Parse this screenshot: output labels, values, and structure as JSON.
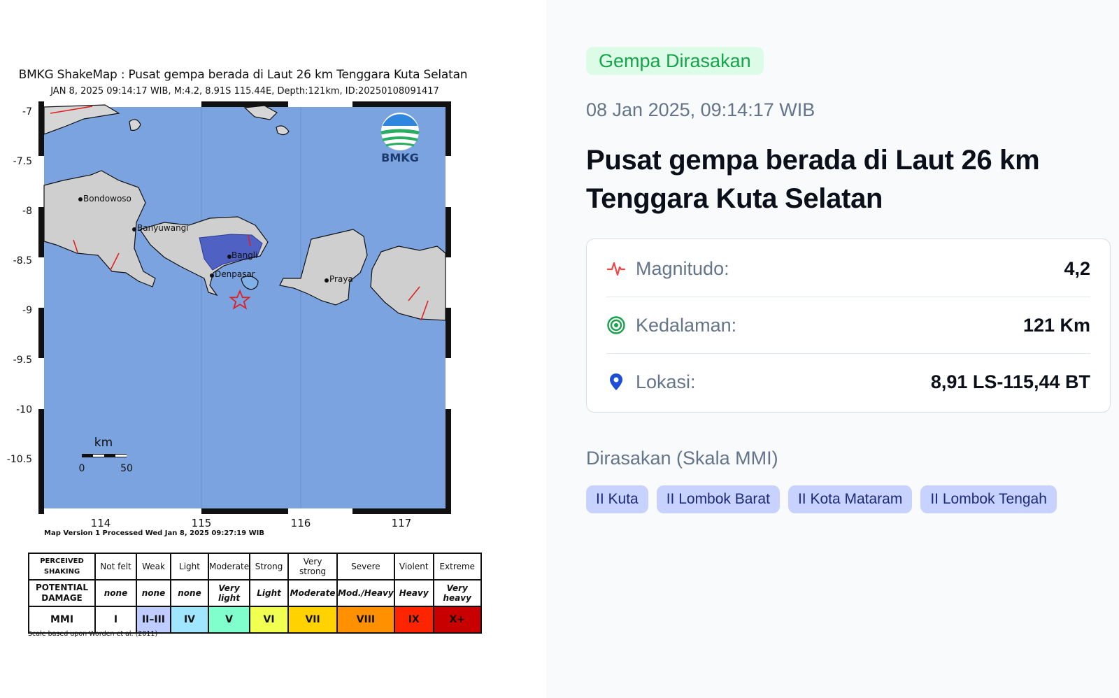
{
  "shakemap": {
    "title": "BMKG ShakeMap : Pusat gempa berada di Laut 26 km Tenggara Kuta Selatan",
    "subtitle": "JAN 8, 2025 09:14:17 WIB, M:4.2, 8.91S 115.44E, Depth:121km, ID:20250108091417",
    "logo_text": "BMKG",
    "lat_ticks": [
      "-7",
      "-7.5",
      "-8",
      "-8.5",
      "-9",
      "-9.5",
      "-10",
      "-10.5"
    ],
    "lon_ticks": [
      "114",
      "115",
      "116",
      "117"
    ],
    "cities": [
      "Bondowoso",
      "Banyuwangi",
      "Bangli",
      "Denpasar",
      "Praya"
    ],
    "scale_unit": "km",
    "scale_min": "0",
    "scale_max": "50",
    "map_version": "Map Version 1 Processed Wed Jan  8, 2025 09:27:19 WIB",
    "scale_note": "Scale based upon Worden et al. (2011)",
    "legend": {
      "perceived_label": "PERCEIVED SHAKING",
      "damage_label": "POTENTIAL DAMAGE",
      "mmi_label": "MMI",
      "perceived": [
        "Not felt",
        "Weak",
        "Light",
        "Moderate",
        "Strong",
        "Very strong",
        "Severe",
        "Violent",
        "Extreme"
      ],
      "damage": [
        "none",
        "none",
        "none",
        "Very light",
        "Light",
        "Moderate",
        "Mod./Heavy",
        "Heavy",
        "Very heavy"
      ],
      "mmi": [
        "I",
        "II–III",
        "IV",
        "V",
        "VI",
        "VII",
        "VIII",
        "IX",
        "X+"
      ],
      "colors": [
        "#ffffff",
        "#bfccff",
        "#a0e6ff",
        "#80ffcc",
        "#f0ff50",
        "#ffd200",
        "#ff9100",
        "#ff2400",
        "#c80000"
      ]
    },
    "colors": {
      "sea": "#7ba3e0",
      "land": "#d6d6d6",
      "felt_area": "#4f62c4",
      "epicenter": "#e02020"
    }
  },
  "event": {
    "badge": "Gempa Dirasakan",
    "datetime": "08 Jan 2025, 09:14:17 WIB",
    "headline": "Pusat gempa berada di Laut 26 km Tenggara Kuta Selatan"
  },
  "details": {
    "magnitude_label": "Magnitudo:",
    "magnitude_value": "4,2",
    "depth_label": "Kedalaman:",
    "depth_value": "121 Km",
    "location_label": "Lokasi:",
    "location_value": "8,91 LS-115,44 BT"
  },
  "felt": {
    "title": "Dirasakan (Skala MMI)",
    "areas": [
      "II Kuta",
      "II Lombok Barat",
      "II Kota Mataram",
      "II Lombok Tengah"
    ]
  },
  "icons": {
    "magnitude": "pulse-icon",
    "depth": "target-icon",
    "location": "map-pin-icon"
  }
}
